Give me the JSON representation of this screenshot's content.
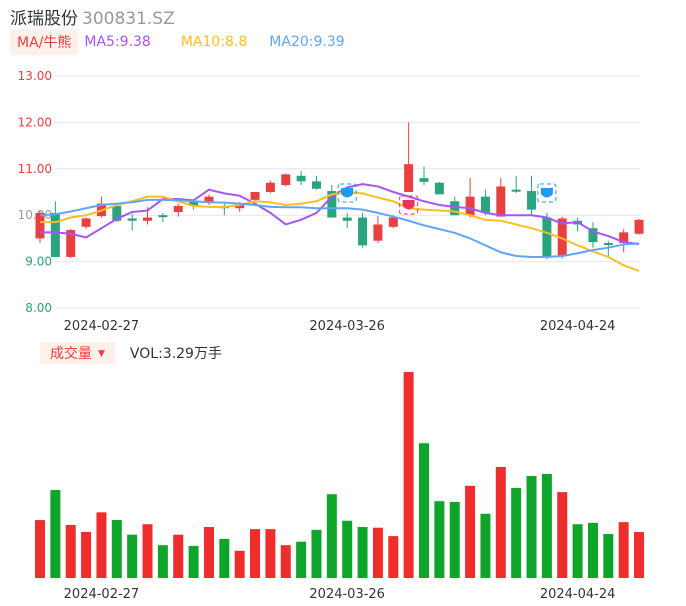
{
  "header": {
    "name": "派瑞股份",
    "code": "300831.SZ"
  },
  "legend": {
    "tag": "MA/牛熊",
    "ma5": "MA5:9.38",
    "ma10": "MA10:8.8",
    "ma20": "MA20:9.39"
  },
  "volume_header": {
    "tag": "成交量",
    "vol": "VOL:3.29万手"
  },
  "colors": {
    "up": "#e84040",
    "down": "#2aa37f",
    "ma5": "#a855f7",
    "ma10": "#fbbf24",
    "ma20": "#60a5fa"
  },
  "chart_data": {
    "type": "candlestick",
    "ylim": [
      8,
      13
    ],
    "y_ticks": [
      "13.00",
      "12.00",
      "11.00",
      "10.00",
      "9.00",
      "8.00"
    ],
    "x_ticks": [
      {
        "index": 4,
        "label": "2024-02-27"
      },
      {
        "index": 20,
        "label": "2024-03-26"
      },
      {
        "index": 35,
        "label": "2024-04-24"
      }
    ],
    "ohlc": [
      [
        9.5,
        10.1,
        9.4,
        10.05
      ],
      [
        10.05,
        10.3,
        9.1,
        9.1
      ],
      [
        9.1,
        9.7,
        9.08,
        9.68
      ],
      [
        9.75,
        9.95,
        9.7,
        9.93
      ],
      [
        9.98,
        10.4,
        9.95,
        10.25
      ],
      [
        10.2,
        10.25,
        9.85,
        9.88
      ],
      [
        9.93,
        10.03,
        9.67,
        9.88
      ],
      [
        9.88,
        10.17,
        9.8,
        9.95
      ],
      [
        10.0,
        10.05,
        9.85,
        9.98
      ],
      [
        10.07,
        10.25,
        9.97,
        10.2
      ],
      [
        10.3,
        10.3,
        10.12,
        10.2
      ],
      [
        10.27,
        10.45,
        10.22,
        10.4
      ],
      [
        10.2,
        10.28,
        10.0,
        10.15
      ],
      [
        10.15,
        10.28,
        10.07,
        10.25
      ],
      [
        10.33,
        10.5,
        10.3,
        10.5
      ],
      [
        10.5,
        10.75,
        10.47,
        10.7
      ],
      [
        10.65,
        10.9,
        10.62,
        10.88
      ],
      [
        10.85,
        10.95,
        10.65,
        10.73
      ],
      [
        10.73,
        10.85,
        10.55,
        10.57
      ],
      [
        10.52,
        10.65,
        9.95,
        9.95
      ],
      [
        9.95,
        10.05,
        9.72,
        9.88
      ],
      [
        9.95,
        10.05,
        9.3,
        9.35
      ],
      [
        9.45,
        9.98,
        9.4,
        9.8
      ],
      [
        9.75,
        10.0,
        9.72,
        9.95
      ],
      [
        10.5,
        12.0,
        10.5,
        11.1
      ],
      [
        10.8,
        11.05,
        10.65,
        10.72
      ],
      [
        10.7,
        10.72,
        10.45,
        10.45
      ],
      [
        10.3,
        10.4,
        10.0,
        10.0
      ],
      [
        10.0,
        10.8,
        9.95,
        10.4
      ],
      [
        10.4,
        10.55,
        10.0,
        10.05
      ],
      [
        9.97,
        10.8,
        9.97,
        10.62
      ],
      [
        10.55,
        10.85,
        10.48,
        10.52
      ],
      [
        10.52,
        10.85,
        9.98,
        10.12
      ],
      [
        9.95,
        10.05,
        9.05,
        9.1
      ],
      [
        9.12,
        9.97,
        9.07,
        9.93
      ],
      [
        9.88,
        9.95,
        9.65,
        9.8
      ],
      [
        9.72,
        9.85,
        9.3,
        9.42
      ],
      [
        9.4,
        9.45,
        9.1,
        9.37
      ],
      [
        9.4,
        9.7,
        9.2,
        9.63
      ],
      [
        9.6,
        9.92,
        9.58,
        9.9
      ]
    ],
    "ma5": [
      9.63,
      9.63,
      9.6,
      9.52,
      9.72,
      9.92,
      10.07,
      10.1,
      10.35,
      10.35,
      10.32,
      10.55,
      10.47,
      10.42,
      10.25,
      10.05,
      9.8,
      9.9,
      10.05,
      10.4,
      10.6,
      10.67,
      10.62,
      10.5,
      10.4,
      10.3,
      10.22,
      10.18,
      10.15,
      10.05,
      10.0,
      10.0,
      10.0,
      9.95,
      9.82,
      9.85,
      9.65,
      9.55,
      9.42,
      9.38
    ],
    "ma10": [
      9.85,
      9.85,
      9.95,
      10.0,
      10.1,
      10.22,
      10.3,
      10.4,
      10.4,
      10.3,
      10.2,
      10.18,
      10.18,
      10.22,
      10.3,
      10.28,
      10.22,
      10.25,
      10.3,
      10.45,
      10.5,
      10.47,
      10.38,
      10.3,
      10.15,
      10.12,
      10.1,
      10.08,
      10.0,
      9.9,
      9.88,
      9.8,
      9.72,
      9.62,
      9.5,
      9.35,
      9.22,
      9.1,
      8.92,
      8.8
    ],
    "ma20": [
      10.0,
      10.02,
      10.08,
      10.15,
      10.22,
      10.25,
      10.28,
      10.33,
      10.33,
      10.32,
      10.3,
      10.28,
      10.27,
      10.25,
      10.22,
      10.18,
      10.17,
      10.17,
      10.15,
      10.15,
      10.15,
      10.12,
      10.05,
      9.97,
      9.88,
      9.78,
      9.7,
      9.62,
      9.5,
      9.35,
      9.2,
      9.12,
      9.1,
      9.1,
      9.12,
      9.18,
      9.25,
      9.3,
      9.37,
      9.39
    ],
    "volume": [
      4.15,
      6.3,
      3.8,
      3.3,
      4.7,
      4.15,
      3.1,
      3.85,
      2.35,
      3.1,
      2.3,
      3.65,
      2.8,
      1.95,
      3.5,
      3.5,
      2.35,
      2.6,
      3.45,
      6.0,
      4.1,
      3.65,
      3.6,
      3.0,
      14.75,
      9.65,
      5.5,
      5.45,
      6.6,
      4.6,
      7.95,
      6.45,
      7.3,
      7.45,
      6.15,
      3.85,
      3.95,
      3.15,
      4.0,
      3.29
    ],
    "volume_unit": "万手",
    "badges": [
      {
        "index": 20,
        "type": "bear",
        "color": "#1e9bf0"
      },
      {
        "index": 24,
        "type": "bull",
        "color": "#f0325a"
      },
      {
        "index": 33,
        "type": "bear",
        "color": "#1e9bf0"
      }
    ]
  }
}
